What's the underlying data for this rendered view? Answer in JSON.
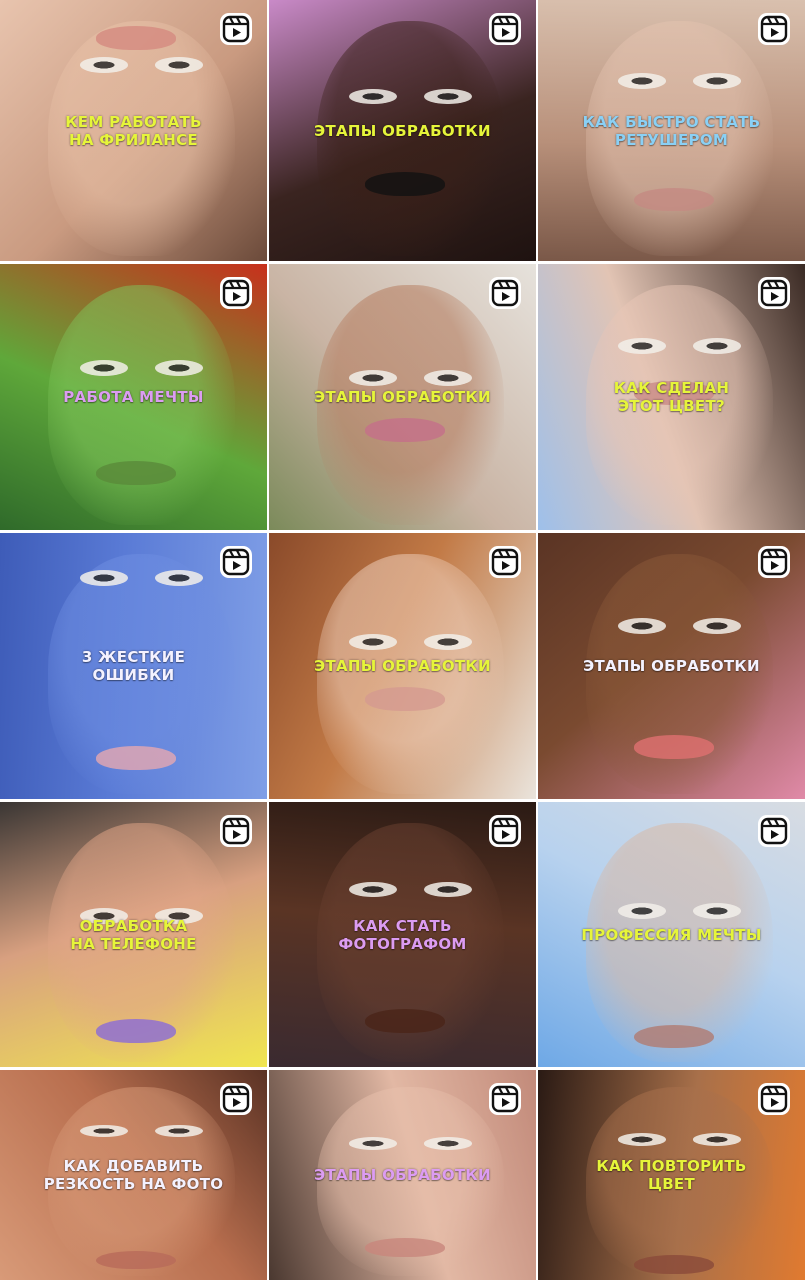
{
  "grid": {
    "tiles": [
      {
        "caption": "КЕМ РАБОТАТЬ\nНА ФРИЛАНСЕ",
        "caption_color": "#e6f53a",
        "bg": [
          "#e8c4ae",
          "#c99a80",
          "#6b4a3a"
        ],
        "skin": "#e9c2a8",
        "lip": "#d48a80",
        "icon": "reels-icon"
      },
      {
        "caption": "ЭТАПЫ ОБРАБОТКИ",
        "caption_color": "#e6f53a",
        "bg": [
          "#c98ac8",
          "#3a2420",
          "#1e1210"
        ],
        "skin": "#3a2018",
        "lip": "#111111",
        "icon": "reels-icon"
      },
      {
        "caption": "КАК БЫСТРО СТАТЬ\nРЕТУШЕРОМ",
        "caption_color": "#8ad0f5",
        "bg": [
          "#d9c0ae",
          "#b8907a",
          "#7a5848"
        ],
        "skin": "#e4c3b0",
        "lip": "#c48a82",
        "icon": "reels-icon"
      },
      {
        "caption": "РАБОТА МЕЧТЫ",
        "caption_color": "#dc9cf2",
        "bg": [
          "#c8301c",
          "#5fa83a",
          "#2f6a2a"
        ],
        "skin": "#7fc45a",
        "lip": "#5a8a3a",
        "icon": "reels-icon"
      },
      {
        "caption": "ЭТАПЫ ОБРАБОТКИ",
        "caption_color": "#e6f53a",
        "bg": [
          "#e6e2dc",
          "#c9b4a4",
          "#7b8a5a"
        ],
        "skin": "#b47a5c",
        "lip": "#c46f8a",
        "icon": "reels-icon"
      },
      {
        "caption": "КАК СДЕЛАН\nЭТОТ ЦВЕТ?",
        "caption_color": "#e6f53a",
        "bg": [
          "#3a2a24",
          "#e2c4b4",
          "#9ec0ea"
        ],
        "skin": "#e8c6b6",
        "lip": "#c98a86",
        "icon": "reels-icon"
      },
      {
        "caption": "3 ЖЕСТКИЕ\nОШИБКИ",
        "caption_color": "#f4f2ff",
        "bg": [
          "#7f9ee6",
          "#5a7bd6",
          "#3e5cb8"
        ],
        "skin": "#6e8ee2",
        "lip": "#e6a8b0",
        "icon": "reels-icon"
      },
      {
        "caption": "ЭТАПЫ ОБРАБОТКИ",
        "caption_color": "#e6f53a",
        "bg": [
          "#eae4dc",
          "#c27a46",
          "#8a4a2a"
        ],
        "skin": "#f0d0bc",
        "lip": "#d49a90",
        "icon": "reels-icon"
      },
      {
        "caption": "ЭТАПЫ ОБРАБОТКИ",
        "caption_color": "#f4f2ff",
        "bg": [
          "#e08aa8",
          "#7a4a30",
          "#5a3424"
        ],
        "skin": "#8a5838",
        "lip": "#e07070",
        "icon": "reels-icon"
      },
      {
        "caption": "ОБРАБОТКА\nНА ТЕЛЕФОНЕ",
        "caption_color": "#e6f53a",
        "bg": [
          "#f0e650",
          "#d8a080",
          "#3a3634"
        ],
        "skin": "#e2a688",
        "lip": "#8a6ad8",
        "icon": "reels-icon"
      },
      {
        "caption": "КАК СТАТЬ\nФОТОГРАФОМ",
        "caption_color": "#dc9cf2",
        "bg": [
          "#3a2a30",
          "#5a3424",
          "#2a1a14"
        ],
        "skin": "#6a4030",
        "lip": "#4a2418",
        "icon": "reels-icon"
      },
      {
        "caption": "ПРОФЕССИЯ МЕЧТЫ",
        "caption_color": "#e6f53a",
        "bg": [
          "#6ea8e6",
          "#b8d2ee",
          "#d8dce2"
        ],
        "skin": "#d8b8a4",
        "lip": "#b07a70",
        "icon": "reels-icon"
      },
      {
        "caption": "КАК ДОБАВИТЬ\nРЕЗКОСТЬ НА ФОТО",
        "caption_color": "#f4f2ff",
        "bg": [
          "#d89a78",
          "#b86e4e",
          "#5a3224"
        ],
        "skin": "#d89a78",
        "lip": "#b86a5a",
        "icon": "reels-icon"
      },
      {
        "caption": "ЭТАПЫ ОБРАБОТКИ",
        "caption_color": "#dc9cf2",
        "bg": [
          "#4a3830",
          "#e2b8a4",
          "#c28a7a"
        ],
        "skin": "#e8c0ac",
        "lip": "#c8867c",
        "icon": "reels-icon"
      },
      {
        "caption": "КАК ПОВТОРИТЬ\nЦВЕТ",
        "caption_color": "#e6f53a",
        "bg": [
          "#2a1a14",
          "#a8704a",
          "#e07a30"
        ],
        "skin": "#a8704c",
        "lip": "#8a4a3a",
        "icon": "reels-icon"
      }
    ]
  }
}
